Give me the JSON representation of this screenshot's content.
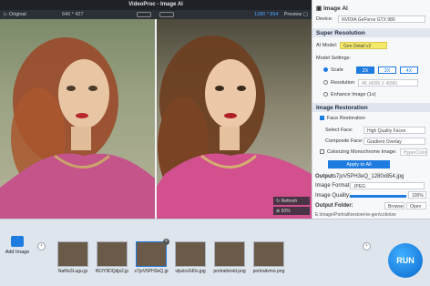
{
  "app": {
    "title": "VideoProc - Image AI"
  },
  "preview": {
    "original_label": "Original",
    "original_dims": "640 * 427",
    "result_dims": "1280 * 854",
    "preview_label": "Preview"
  },
  "photo_controls": {
    "refresh_label": "Refresh",
    "zoom_value": "50%"
  },
  "panel": {
    "header": "Image AI",
    "device_label": "Device:",
    "device_value": "NVIDIA GeForce GTX 980",
    "super_resolution": {
      "title": "Super Resolution",
      "model_label": "AI Model:",
      "model_value": "Gen Detail v2",
      "model_settings_label": "Model Settings:",
      "scale_label": "Scale",
      "scale_options": [
        "2X",
        "3X",
        "4X"
      ],
      "resolution_label": "Resolution",
      "resolution_value": "4K (4096 X 4096)",
      "enhance_label": "Enhance Image (1x)"
    },
    "restoration": {
      "title": "Image Restoration",
      "face_restoration_label": "Face Restoration",
      "select_face_label": "Select Face:",
      "select_face_value": "High Quality Faces",
      "composite_face_label": "Composite Face:",
      "composite_face_value": "Gradient Overlay",
      "colorizing_label": "Colorizing Monochrome Image:",
      "colorizing_value": "HyperColor"
    },
    "apply_all_label": "Apply to All",
    "output_label": "Output:",
    "output_value": "s7joV5PH3eQ_1280x854.jpg",
    "image_format_label": "Image Format:",
    "image_format_value": "JPEG",
    "image_quality_label": "Image Quality:",
    "image_quality_value": "100%",
    "image_quality_fraction": 1.0,
    "output_folder_label": "Output Folder:",
    "output_folder_path": "E:\\image\\Portrait\\restore\\re-gen\\colorize",
    "browse_label": "Browse",
    "open_label": "Open"
  },
  "bottom": {
    "add_image_label": "Add Image",
    "run_label": "RUN",
    "thumbnails": [
      {
        "name": "Nafrls3Lugu.jp"
      },
      {
        "name": "f6OY9DQdjs2.jp"
      },
      {
        "name": "s7joV5PH3eQ.jp",
        "selected": true
      },
      {
        "name": "vlpzirs2d0o.jpg"
      },
      {
        "name": "portraitvivid.png"
      },
      {
        "name": "portraitvmo.png"
      }
    ]
  },
  "colors": {
    "accent": "#1e7be0",
    "titlebar": "#1e2126",
    "panel_bg": "#f7f8fa"
  }
}
